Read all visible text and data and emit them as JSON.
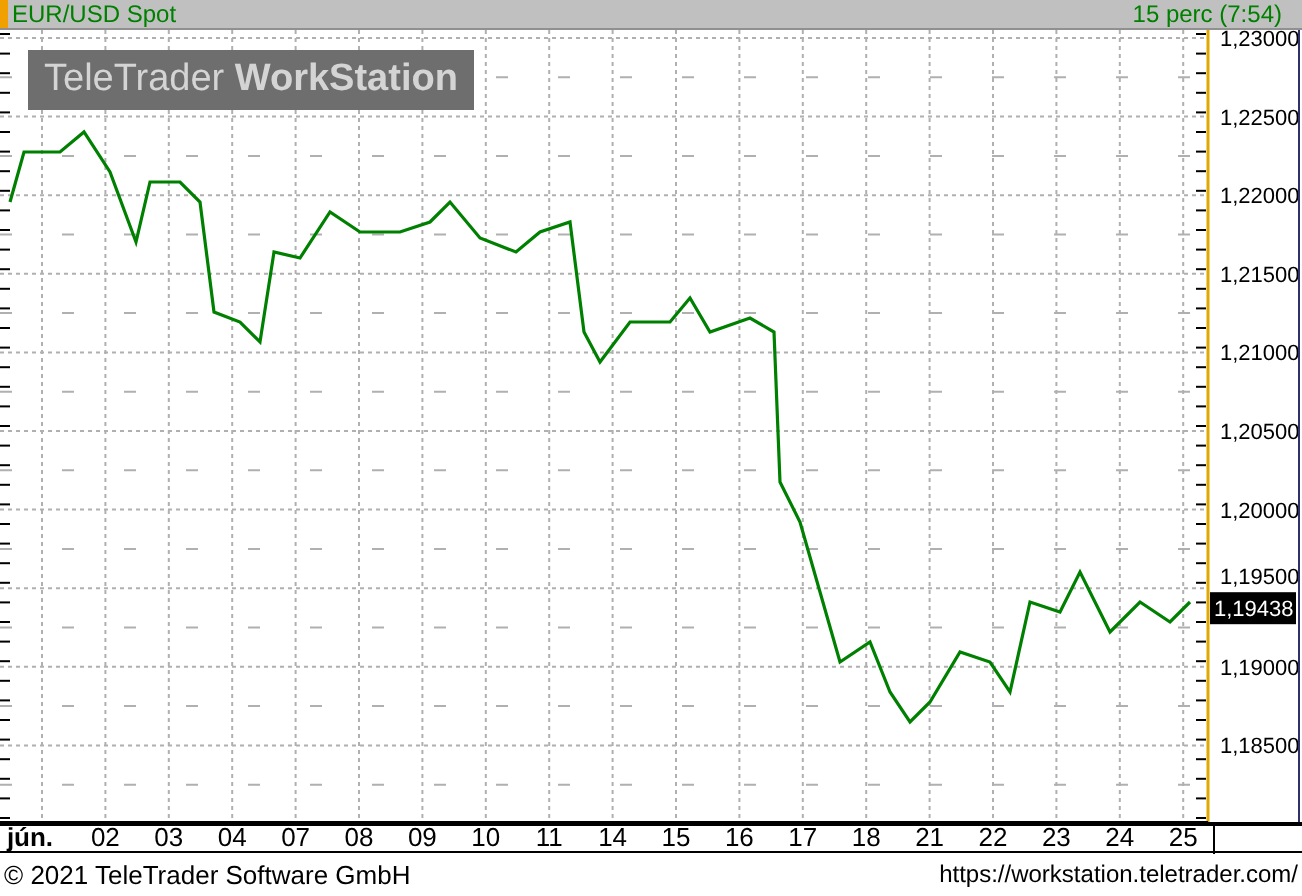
{
  "header": {
    "symbol": "EUR/USD Spot",
    "interval": "15 perc (7:54)"
  },
  "logo": "TeleTrader **WorkStation**",
  "chart": {
    "last_price": "1,19438",
    "y_axis_labels": [
      "1,23000",
      "1,22500",
      "1,22000",
      "1,21500",
      "1,21000",
      "1,20500",
      "1,20000",
      "1,19500",
      "1,19000",
      "1,18500"
    ],
    "x_axis_labels": [
      "jún.",
      "02",
      "03",
      "04",
      "07",
      "08",
      "09",
      "10",
      "11",
      "14",
      "15",
      "16",
      "17",
      "18",
      "21",
      "22",
      "23",
      "24",
      "25"
    ]
  },
  "footer": {
    "copyright": "© 2021 TeleTrader Software GmbH",
    "url": "https://workstation.teletrader.com/"
  }
}
